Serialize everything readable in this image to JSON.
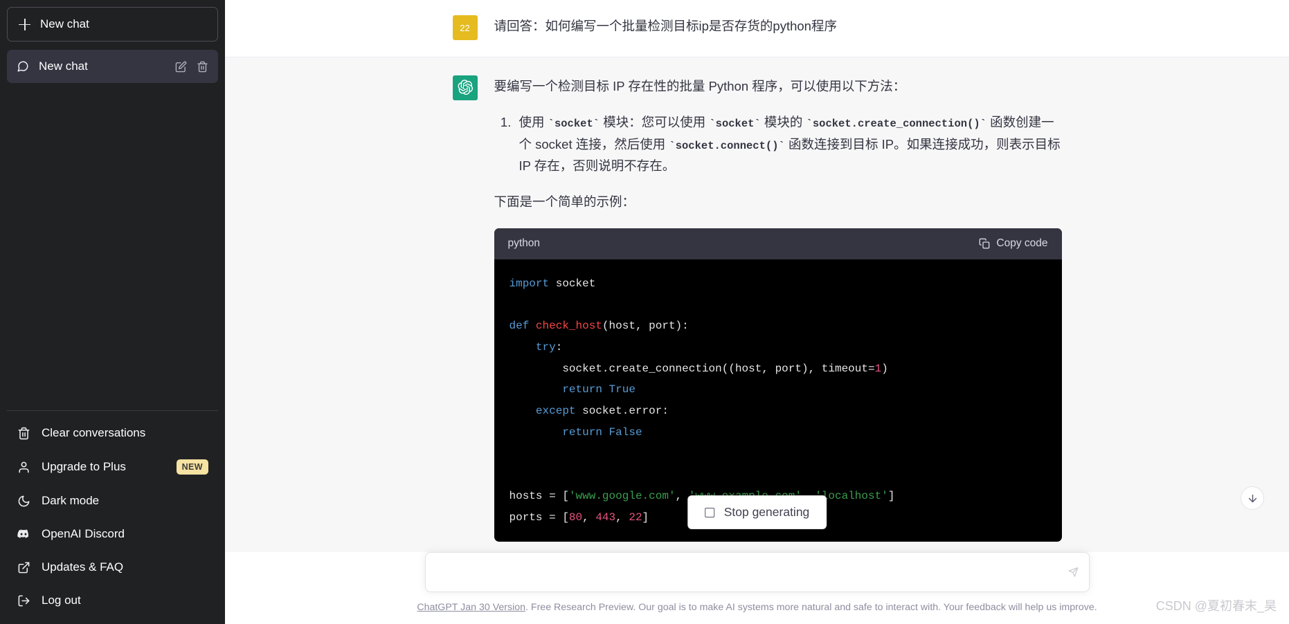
{
  "sidebar": {
    "new_chat_label": "New chat",
    "chats": [
      {
        "label": "New chat",
        "edit_icon": "pencil-icon",
        "delete_icon": "trash-icon"
      }
    ],
    "bottom_items": [
      {
        "icon": "trash-icon",
        "label": "Clear conversations",
        "badge": ""
      },
      {
        "icon": "user-icon",
        "label": "Upgrade to Plus",
        "badge": "NEW"
      },
      {
        "icon": "moon-icon",
        "label": "Dark mode",
        "badge": ""
      },
      {
        "icon": "discord-icon",
        "label": "OpenAI Discord",
        "badge": ""
      },
      {
        "icon": "external-link-icon",
        "label": "Updates & FAQ",
        "badge": ""
      },
      {
        "icon": "logout-icon",
        "label": "Log out",
        "badge": ""
      }
    ]
  },
  "conversation": {
    "user": {
      "avatar_text": "22",
      "text": "请回答：如何编写一个批量检测目标ip是否存货的python程序"
    },
    "assistant": {
      "avatar_icon": "openai-logo-icon",
      "intro": "要编写一个检测目标 IP 存在性的批量 Python 程序，可以使用以下方法：",
      "list_items": [
        {
          "seg1": "使用 ",
          "code1": "`socket`",
          "seg2": " 模块：您可以使用 ",
          "code2": "`socket`",
          "seg3": " 模块的 ",
          "code3": "`socket.create_connection()`",
          "seg4": " 函数创建一个 socket 连接，然后使用 ",
          "code4": "`socket.connect()`",
          "seg5": " 函数连接到目标 IP。如果连接成功，则表示目标 IP 存在，否则说明不存在。"
        }
      ],
      "example_lead": "下面是一个简单的示例：",
      "codeblock": {
        "language": "python",
        "copy_label": "Copy code",
        "lines": [
          [
            {
              "t": "import",
              "c": "kw"
            },
            {
              "t": " socket",
              "c": "plain"
            }
          ],
          [],
          [
            {
              "t": "def",
              "c": "kw"
            },
            {
              "t": " ",
              "c": "plain"
            },
            {
              "t": "check_host",
              "c": "fn"
            },
            {
              "t": "(host, port):",
              "c": "plain"
            }
          ],
          [
            {
              "t": "    ",
              "c": "plain"
            },
            {
              "t": "try",
              "c": "kw"
            },
            {
              "t": ":",
              "c": "plain"
            }
          ],
          [
            {
              "t": "        socket.create_connection((host, port), timeout=",
              "c": "plain"
            },
            {
              "t": "1",
              "c": "num"
            },
            {
              "t": ")",
              "c": "plain"
            }
          ],
          [
            {
              "t": "        ",
              "c": "plain"
            },
            {
              "t": "return",
              "c": "kw"
            },
            {
              "t": " ",
              "c": "plain"
            },
            {
              "t": "True",
              "c": "lit"
            }
          ],
          [
            {
              "t": "    ",
              "c": "plain"
            },
            {
              "t": "except",
              "c": "kw"
            },
            {
              "t": " socket.error:",
              "c": "plain"
            }
          ],
          [
            {
              "t": "        ",
              "c": "plain"
            },
            {
              "t": "return",
              "c": "kw"
            },
            {
              "t": " ",
              "c": "plain"
            },
            {
              "t": "False",
              "c": "lit"
            }
          ],
          [],
          [],
          [
            {
              "t": "hosts = [",
              "c": "plain"
            },
            {
              "t": "'www.google.com'",
              "c": "str"
            },
            {
              "t": ", ",
              "c": "plain"
            },
            {
              "t": "'www.example.com'",
              "c": "str"
            },
            {
              "t": ", ",
              "c": "plain"
            },
            {
              "t": "'localhost'",
              "c": "str"
            },
            {
              "t": "]",
              "c": "plain"
            }
          ],
          [
            {
              "t": "ports = [",
              "c": "plain"
            },
            {
              "t": "80",
              "c": "num"
            },
            {
              "t": ", ",
              "c": "plain"
            },
            {
              "t": "443",
              "c": "num"
            },
            {
              "t": ", ",
              "c": "plain"
            },
            {
              "t": "22",
              "c": "num"
            },
            {
              "t": "]",
              "c": "plain"
            }
          ]
        ]
      }
    }
  },
  "stop_generating": {
    "label": "Stop generating"
  },
  "composer": {
    "value": "",
    "placeholder": "",
    "send_icon": "send-icon"
  },
  "footer": {
    "link_text": "ChatGPT Jan 30 Version",
    "rest_text": ". Free Research Preview. Our goal is to make AI systems more natural and safe to interact with. Your feedback will help us improve."
  },
  "scroll_down": {
    "icon": "arrow-down-icon"
  },
  "watermark": {
    "text": "CSDN @夏初春末_昊"
  },
  "colors": {
    "sidebar_bg": "#202123",
    "chat_active_bg": "#343541",
    "assistant_bg": "#f7f7f8",
    "user_avatar": "#e5bb1f",
    "assistant_avatar": "#19a37f",
    "badge_new": "#f6e2a2",
    "code_header_bg": "#343541",
    "code_body_bg": "#000000"
  }
}
